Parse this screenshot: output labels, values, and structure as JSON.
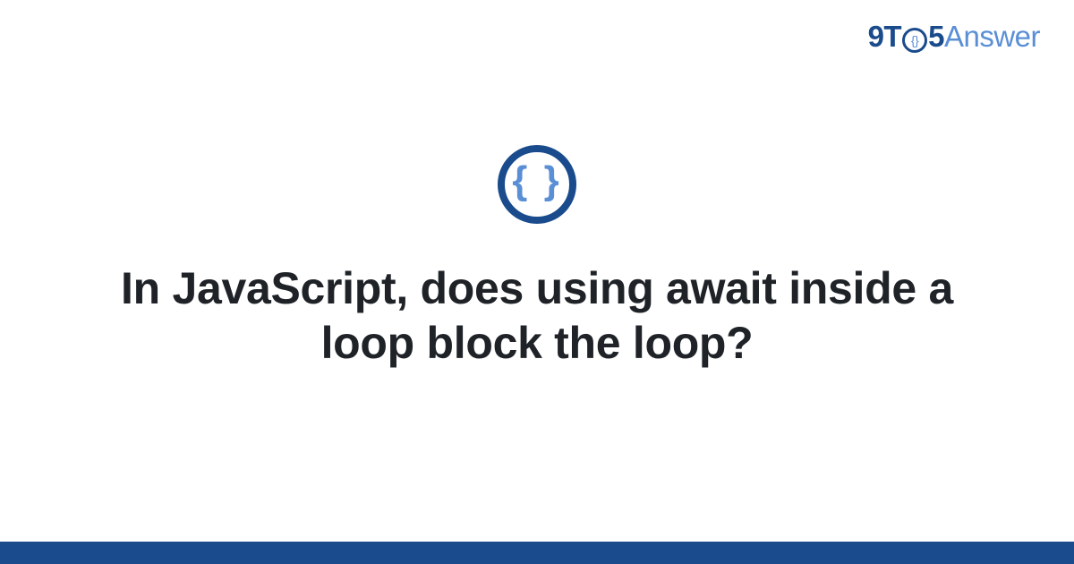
{
  "logo": {
    "part1": "9",
    "part2": "T",
    "clock_inner": "{}",
    "part3": "5",
    "part4": "Answer"
  },
  "icon": {
    "braces": "{ }"
  },
  "title": "In JavaScript, does using await inside a loop block the loop?",
  "colors": {
    "primary": "#1a4b8c",
    "secondary": "#5a8fd6",
    "text": "#1f2328"
  }
}
